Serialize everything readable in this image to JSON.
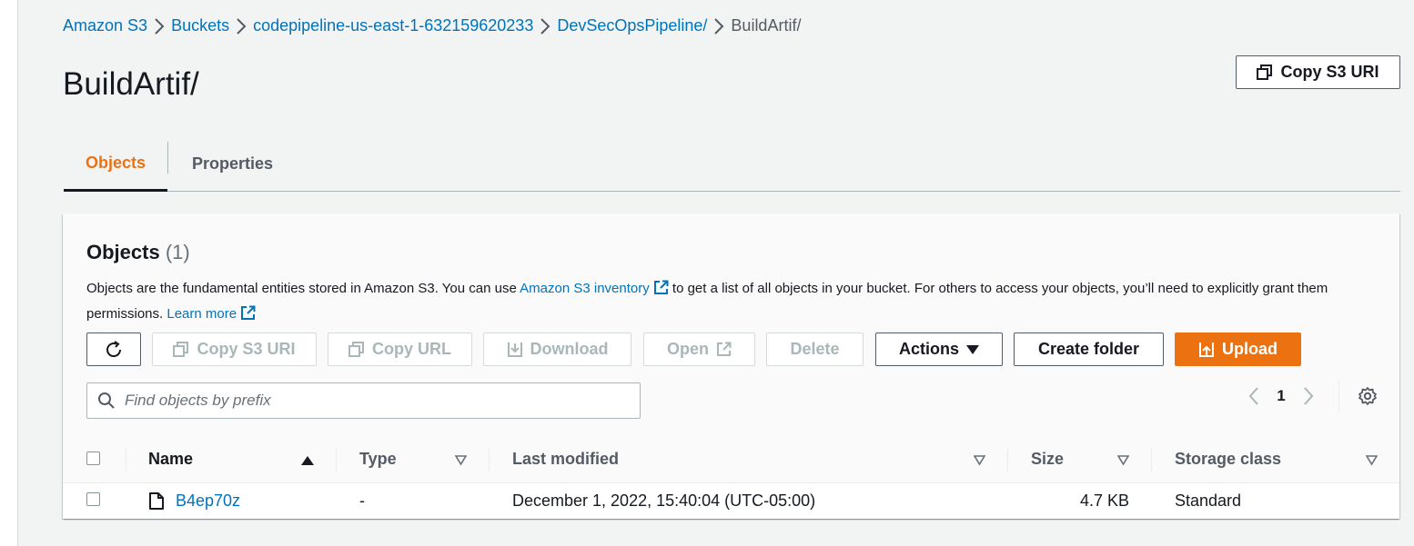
{
  "breadcrumb": [
    {
      "label": "Amazon S3"
    },
    {
      "label": "Buckets"
    },
    {
      "label": "codepipeline-us-east-1-632159620233"
    },
    {
      "label": "DevSecOpsPipeline/"
    },
    {
      "label": "BuildArtif/"
    }
  ],
  "page_title": "BuildArtif/",
  "copy_s3_uri_label": "Copy S3 URI",
  "tabs": [
    {
      "label": "Objects",
      "active": true
    },
    {
      "label": "Properties",
      "active": false
    }
  ],
  "objects_panel": {
    "title": "Objects",
    "count": "(1)",
    "description_part1": "Objects are the fundamental entities stored in Amazon S3. You can use",
    "inventory_link": "Amazon S3 inventory",
    "description_part2": "to get a list of all objects in your bucket. For others to access your objects, you’ll need to explicitly grant them permissions.",
    "learn_more": "Learn more"
  },
  "toolbar": {
    "copy_s3_uri": "Copy S3 URI",
    "copy_url": "Copy URL",
    "download": "Download",
    "open": "Open",
    "delete": "Delete",
    "actions": "Actions",
    "create_folder": "Create folder",
    "upload": "Upload"
  },
  "search": {
    "placeholder": "Find objects by prefix",
    "value": ""
  },
  "pagination": {
    "current_page": "1"
  },
  "table": {
    "columns": [
      "Name",
      "Type",
      "Last modified",
      "Size",
      "Storage class"
    ],
    "rows": [
      {
        "name": "B4ep70z",
        "type": "-",
        "last_modified": "December 1, 2022, 15:40:04 (UTC-05:00)",
        "size": "4.7 KB",
        "storage_class": "Standard"
      }
    ]
  },
  "colors": {
    "accent": "#ec7211",
    "link": "#0073bb",
    "text": "#16191f",
    "muted": "#545b64",
    "disabled": "#aab7b8"
  }
}
